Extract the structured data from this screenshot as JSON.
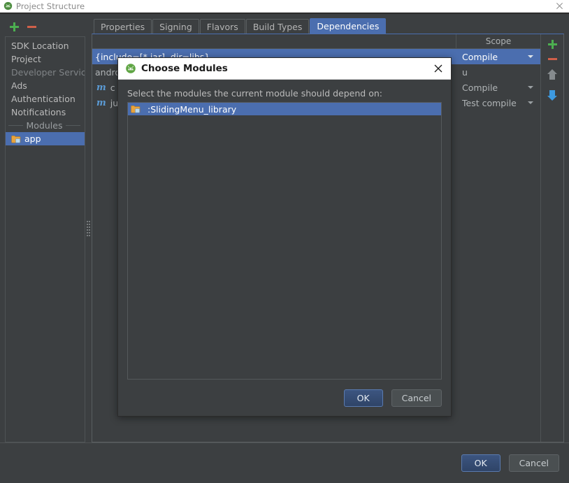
{
  "window": {
    "title": "Project Structure",
    "icon": "android-studio-icon",
    "close_label": "✕"
  },
  "left_toolbar": {
    "add_label": "+",
    "remove_label": "−"
  },
  "sidebar": {
    "items": [
      {
        "label": "SDK Location",
        "type": "item",
        "selected": false
      },
      {
        "label": "Project",
        "type": "item",
        "selected": false
      },
      {
        "label": "Developer Services",
        "type": "group",
        "selected": false
      },
      {
        "label": "Ads",
        "type": "item",
        "selected": false
      },
      {
        "label": "Authentication",
        "type": "item",
        "selected": false
      },
      {
        "label": "Notifications",
        "type": "item",
        "selected": false
      },
      {
        "label": "Modules",
        "type": "separator",
        "selected": false
      },
      {
        "label": "app",
        "type": "module",
        "selected": true
      }
    ]
  },
  "tabs": [
    {
      "label": "Properties",
      "active": false
    },
    {
      "label": "Signing",
      "active": false
    },
    {
      "label": "Flavors",
      "active": false
    },
    {
      "label": "Build Types",
      "active": false
    },
    {
      "label": "Dependencies",
      "active": true
    }
  ],
  "dependencies": {
    "columns": [
      "",
      "Scope"
    ],
    "rows": [
      {
        "icon": "",
        "name": "{include=[*.jar], dir=libs}",
        "scope": "Compile",
        "selected": true
      },
      {
        "icon": "",
        "name": "android",
        "scope": "u",
        "selected": false
      },
      {
        "icon": "m",
        "name": "c",
        "scope": "Compile",
        "selected": false
      },
      {
        "icon": "m",
        "name": "ju",
        "scope": "Test compile",
        "selected": false
      }
    ],
    "toolbar": {
      "add_label": "+",
      "remove_label": "−",
      "move_up_label": "Move Up",
      "move_down_label": "Move Down"
    }
  },
  "window_footer": {
    "ok_label": "OK",
    "cancel_label": "Cancel"
  },
  "dialog": {
    "title": "Choose Modules",
    "icon": "android-studio-icon",
    "close_label": "✕",
    "prompt": "Select the modules the current module should depend on:",
    "modules": [
      {
        "label": ":SlidingMenu_library",
        "selected": true
      }
    ],
    "ok_label": "OK",
    "cancel_label": "Cancel"
  },
  "colors": {
    "accent_blue": "#4b6eaf",
    "panel_bg": "#3c3f41",
    "add_green": "#4caf50",
    "remove_red": "#d0604a",
    "arrow_blue": "#3d9ae0"
  }
}
